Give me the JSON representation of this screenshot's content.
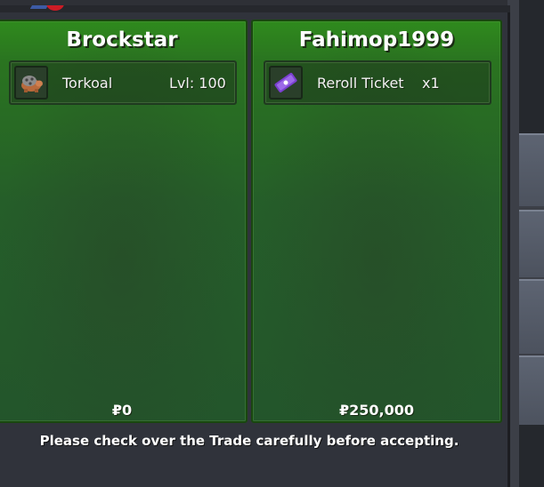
{
  "trade": {
    "left": {
      "trader": "Brockstar",
      "item": {
        "icon": "torkoal-icon",
        "name": "Torkoal",
        "detail": "Lvl: 100"
      },
      "money": "₽0"
    },
    "right": {
      "trader": "Fahimop1999",
      "item": {
        "icon": "reroll-ticket-icon",
        "name": "Reroll Ticket",
        "detail": "x1"
      },
      "money": "₽250,000"
    },
    "notice": "Please check over the Trade carefully before accepting."
  },
  "colors": {
    "panel_top": "#2f8a1d",
    "panel_bottom": "#23552b",
    "window_bg": "#30333b"
  }
}
